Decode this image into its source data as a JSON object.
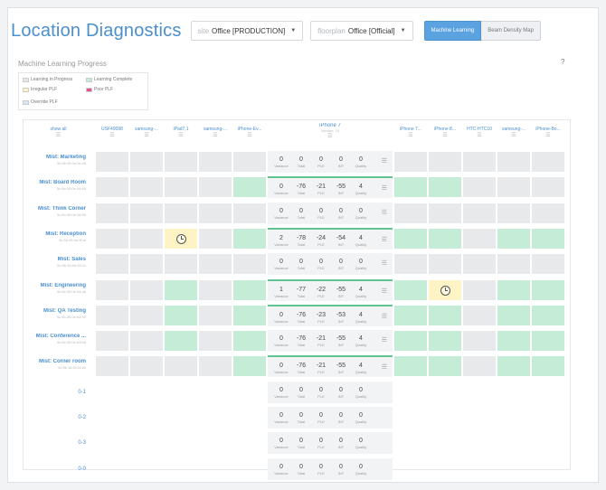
{
  "header": {
    "title": "Location Diagnostics",
    "site": {
      "label": "site",
      "value": "Office [PRODUCTION]"
    },
    "floorplan": {
      "label": "floorplan",
      "value": "Office [Official]"
    },
    "view_toggle": {
      "active": "Machine Learning",
      "inactive": "Beam Density Map"
    }
  },
  "section": {
    "title": "Machine Learning Progress",
    "help_glyph": "?"
  },
  "legend": {
    "items": [
      {
        "label": "Learning in Progress",
        "color": "#e6e7e8"
      },
      {
        "label": "Learning Complete",
        "color": "#c5ecd6"
      },
      {
        "label": "Irregular PLF",
        "color": "#fdf3c5"
      },
      {
        "label": "Poor PLF",
        "color": "#e8538f"
      },
      {
        "label": "Override PLF",
        "color": "#d2e6f7"
      }
    ]
  },
  "columns": [
    {
      "label": "show all",
      "sub": ""
    },
    {
      "label": "USF49098",
      "sub": ""
    },
    {
      "label": "samsung-...",
      "sub": ""
    },
    {
      "label": "iPad7,1",
      "sub": ""
    },
    {
      "label": "samsung-...",
      "sub": ""
    },
    {
      "label": "iPhone-Ev...",
      "sub": ""
    },
    {
      "label": "iPhone 7",
      "sub": "Median: 76"
    },
    {
      "label": "iPhone 7...",
      "sub": ""
    },
    {
      "label": "iPhone 8...",
      "sub": ""
    },
    {
      "label": "HTC-HTC10",
      "sub": ""
    },
    {
      "label": "samsung-...",
      "sub": ""
    },
    {
      "label": "iPhone-Bo...",
      "sub": ""
    }
  ],
  "stat_labels": [
    "Variance",
    "Total",
    "PLE",
    "INT",
    "Quality"
  ],
  "rows": [
    {
      "name": "Mist: Marketing",
      "mac": "5c:5b:35:0e:3c:d5",
      "stats": [
        "0",
        "0",
        "0",
        "0",
        "0"
      ]
    },
    {
      "name": "Mist: Board Room",
      "mac": "5c:5b:35:0e:04:60",
      "stats": [
        "0",
        "-76",
        "-21",
        "-55",
        "4"
      ]
    },
    {
      "name": "Mist: Think Corner",
      "mac": "5c:5b:35:0e:06:55",
      "stats": [
        "0",
        "0",
        "0",
        "0",
        "0"
      ]
    },
    {
      "name": "Mist: Reception",
      "mac": "5c:5b:35:0e:3f:af",
      "stats": [
        "2",
        "-78",
        "-24",
        "-54",
        "4"
      ]
    },
    {
      "name": "Mist: Sales",
      "mac": "5c:5b:35:0e:33:11",
      "stats": [
        "0",
        "0",
        "0",
        "0",
        "0"
      ]
    },
    {
      "name": "Mist: Engineering",
      "mac": "5c:5b:35:0e:04:ab",
      "stats": [
        "1",
        "-77",
        "-22",
        "-55",
        "4"
      ]
    },
    {
      "name": "Mist: QA Testing",
      "mac": "5c:5b:35:0e:04:42",
      "stats": [
        "0",
        "-76",
        "-23",
        "-53",
        "4"
      ]
    },
    {
      "name": "Mist: Conference ...",
      "mac": "5c:5b:35:0e:03:b8",
      "stats": [
        "0",
        "-76",
        "-21",
        "-55",
        "4"
      ]
    },
    {
      "name": "Mist: Corner room",
      "mac": "5c:5b:35:0f:33:dc",
      "stats": [
        "0",
        "-76",
        "-21",
        "-55",
        "4"
      ]
    },
    {
      "name": "0-1",
      "mac": "",
      "stats": [
        "0",
        "0",
        "0",
        "0",
        "0"
      ]
    },
    {
      "name": "0-2",
      "mac": "",
      "stats": [
        "0",
        "0",
        "0",
        "0",
        "0"
      ]
    },
    {
      "name": "0-3",
      "mac": "",
      "stats": [
        "0",
        "0",
        "0",
        "0",
        "0"
      ]
    },
    {
      "name": "0-0",
      "mac": "",
      "stats": [
        "0",
        "0",
        "0",
        "0",
        "0"
      ]
    }
  ],
  "cell_states": [
    [
      "p",
      "p",
      "p",
      "p",
      "p",
      "p",
      "p",
      "p",
      "p",
      "p"
    ],
    [
      "p",
      "p",
      "p",
      "p",
      "c",
      "c",
      "c",
      "p",
      "p",
      "p"
    ],
    [
      "p",
      "p",
      "p",
      "p",
      "p",
      "p",
      "p",
      "p",
      "p",
      "p"
    ],
    [
      "p",
      "p",
      "i",
      "p",
      "c",
      "c",
      "c",
      "p",
      "c",
      "c"
    ],
    [
      "p",
      "p",
      "p",
      "p",
      "p",
      "p",
      "p",
      "p",
      "p",
      "p"
    ],
    [
      "p",
      "p",
      "c",
      "p",
      "c",
      "c",
      "i",
      "p",
      "c",
      "c"
    ],
    [
      "p",
      "p",
      "c",
      "p",
      "c",
      "c",
      "c",
      "p",
      "c",
      "c"
    ],
    [
      "p",
      "p",
      "c",
      "p",
      "c",
      "c",
      "c",
      "p",
      "c",
      "c"
    ],
    [
      "p",
      "p",
      "p",
      "p",
      "c",
      "c",
      "c",
      "p",
      "c",
      "c"
    ]
  ],
  "state_colors": {
    "p": "#e8e9ea",
    "c": "#c5ecd6",
    "i": "#fdf3c5"
  },
  "progress_rows": [
    1,
    3,
    5,
    6,
    8
  ]
}
